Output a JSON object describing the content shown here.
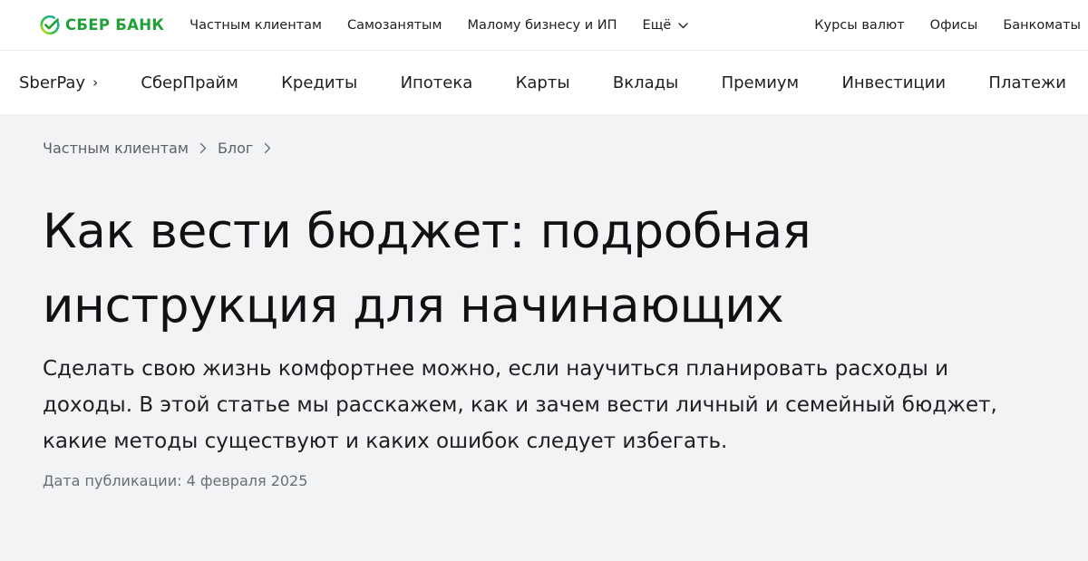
{
  "header": {
    "logo_text": "СБЕР БАНК",
    "brand_color": "#21a038",
    "segments": [
      "Частным клиентам",
      "Самозанятым",
      "Малому бизнесу и ИП"
    ],
    "more_label": "Ещё",
    "utilities": [
      "Курсы валют",
      "Офисы",
      "Банкоматы"
    ]
  },
  "product_nav": {
    "items": [
      "SberPay",
      "СберПрайм",
      "Кредиты",
      "Ипотека",
      "Карты",
      "Вклады",
      "Премиум",
      "Инвестиции",
      "Платежи"
    ],
    "first_item_arrow": "›"
  },
  "breadcrumb": {
    "items": [
      "Частным клиентам",
      "Блог"
    ]
  },
  "article": {
    "title_line1": "Как вести бюджет: подробная",
    "title_line2": "инструкция для начинающих",
    "lead": "Сделать свою жизнь комфортнее можно, если научиться планировать расходы и доходы. В этой статье мы расскажем, как и зачем вести личный и семейный бюджет, какие методы существуют и каких ошибок следует избегать.",
    "publication_date": "Дата публикации: 4 февраля 2025"
  },
  "icons": {
    "logo": "sber-logo-icon",
    "more": "chevron-down-icon",
    "breadcrumb_separator": "chevron-right-icon"
  }
}
